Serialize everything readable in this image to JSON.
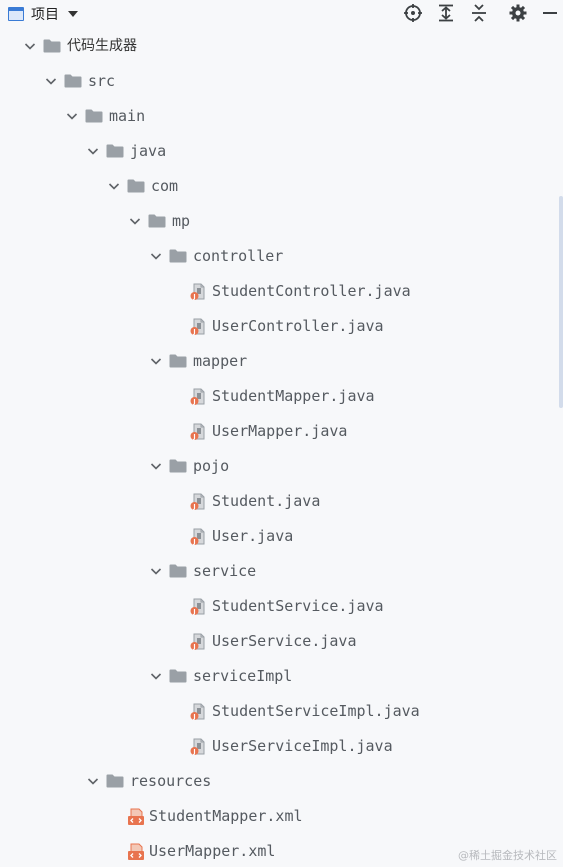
{
  "toolbar": {
    "title": "项目",
    "buttons": [
      {
        "name": "locate-icon"
      },
      {
        "name": "expand-all-icon"
      },
      {
        "name": "collapse-all-icon"
      },
      {
        "name": "gear-icon"
      },
      {
        "name": "minimize-icon"
      }
    ]
  },
  "tree": [
    {
      "label": "代码生成器",
      "kind": "folder",
      "depth": 0,
      "expanded": true
    },
    {
      "label": "src",
      "kind": "folder",
      "depth": 1,
      "expanded": true
    },
    {
      "label": "main",
      "kind": "folder",
      "depth": 2,
      "expanded": true
    },
    {
      "label": "java",
      "kind": "folder",
      "depth": 3,
      "expanded": true
    },
    {
      "label": "com",
      "kind": "folder",
      "depth": 4,
      "expanded": true
    },
    {
      "label": "mp",
      "kind": "folder",
      "depth": 5,
      "expanded": true
    },
    {
      "label": "controller",
      "kind": "folder",
      "depth": 6,
      "expanded": true
    },
    {
      "label": "StudentController.java",
      "kind": "java",
      "depth": 7
    },
    {
      "label": "UserController.java",
      "kind": "java",
      "depth": 7
    },
    {
      "label": "mapper",
      "kind": "folder",
      "depth": 6,
      "expanded": true
    },
    {
      "label": "StudentMapper.java",
      "kind": "java",
      "depth": 7
    },
    {
      "label": "UserMapper.java",
      "kind": "java",
      "depth": 7
    },
    {
      "label": "pojo",
      "kind": "folder",
      "depth": 6,
      "expanded": true
    },
    {
      "label": "Student.java",
      "kind": "java",
      "depth": 7
    },
    {
      "label": "User.java",
      "kind": "java",
      "depth": 7
    },
    {
      "label": "service",
      "kind": "folder",
      "depth": 6,
      "expanded": true
    },
    {
      "label": "StudentService.java",
      "kind": "java",
      "depth": 7
    },
    {
      "label": "UserService.java",
      "kind": "java",
      "depth": 7
    },
    {
      "label": "serviceImpl",
      "kind": "folder",
      "depth": 6,
      "expanded": true
    },
    {
      "label": "StudentServiceImpl.java",
      "kind": "java",
      "depth": 7
    },
    {
      "label": "UserServiceImpl.java",
      "kind": "java",
      "depth": 7
    },
    {
      "label": "resources",
      "kind": "folder",
      "depth": 3,
      "expanded": true
    },
    {
      "label": "StudentMapper.xml",
      "kind": "xml",
      "depth": 4
    },
    {
      "label": "UserMapper.xml",
      "kind": "xml",
      "depth": 4
    }
  ],
  "watermark": "@稀土掘金技术社区",
  "colors": {
    "folder": "#9aa0a6",
    "chevron": "#5f6368",
    "text": "#555a60",
    "accent": "#3a7bd5",
    "xml": "#e8744f",
    "java_badge": "#e8744f"
  }
}
